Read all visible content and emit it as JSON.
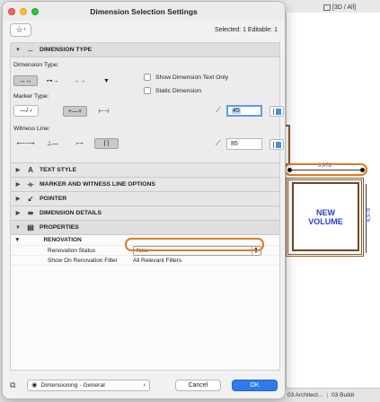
{
  "window": {
    "title": "Dimension Selection Settings"
  },
  "topbar": {
    "favorites_icon": "star-icon",
    "selection_info": "Selected: 1 Editable: 1"
  },
  "sections": {
    "dimension_type": {
      "label": "DIMENSION TYPE",
      "dimension_type_label": "Dimension Type:",
      "marker_type_label": "Marker Type:",
      "witness_line_label": "Witness Line:",
      "show_dimension_text_only": "Show Dimension Text Only",
      "static_dimension": "Static Dimension",
      "marker_size_value": "45",
      "witness_length_value": "85"
    },
    "text_style": {
      "label": "TEXT STYLE"
    },
    "marker_witness": {
      "label": "MARKER AND WITNESS LINE OPTIONS"
    },
    "pointer": {
      "label": "POINTER"
    },
    "dimension_details": {
      "label": "DIMENSION DETAILS"
    },
    "properties": {
      "label": "PROPERTIES"
    }
  },
  "properties": {
    "group": "RENOVATION",
    "rows": [
      {
        "key": "Renovation Status",
        "value": "New"
      },
      {
        "key": "Show On Renovation Filter",
        "value": "All Relevant Filters"
      }
    ]
  },
  "footer": {
    "layer_value": "Dimensioning - General",
    "cancel_label": "Cancel",
    "ok_label": "OK"
  },
  "background": {
    "view_tab": "[3D / All]",
    "dimension_value": "6,978",
    "vertical_dimension_value": "6,978",
    "volume_label_line1": "NEW",
    "volume_label_line2": "VOLUME",
    "bottom_tab_1": "03 Architect...",
    "bottom_tab_2": "03 Buildi"
  },
  "colors": {
    "accent": "#2f7bea",
    "highlight": "#e07b20",
    "dimension_text": "#2a3bd6",
    "wall": "#8b5a2b"
  }
}
